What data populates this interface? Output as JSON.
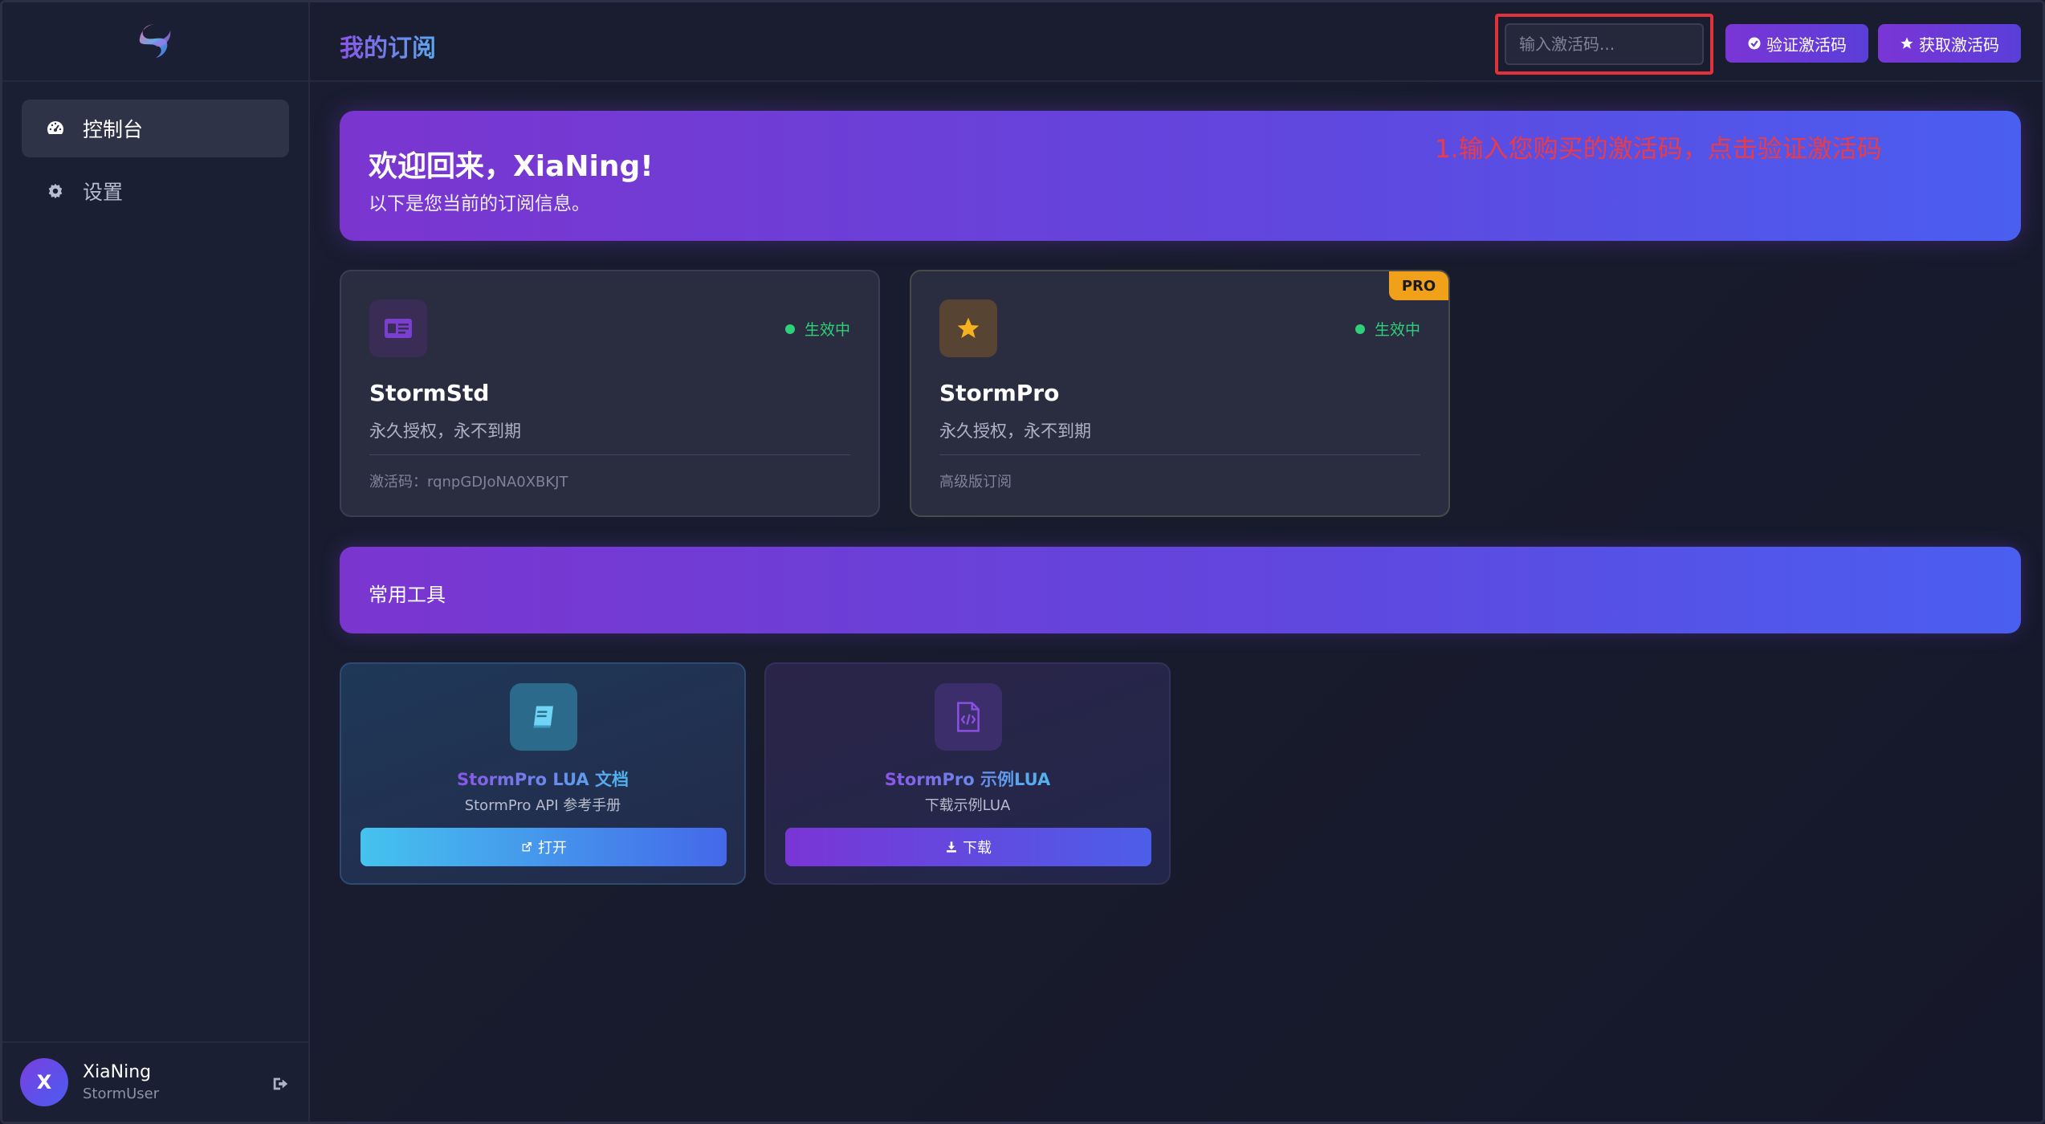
{
  "header": {
    "title": "我的订阅",
    "code_placeholder": "输入激活码...",
    "verify_label": "验证激活码",
    "get_label": "获取激活码"
  },
  "sidebar": {
    "items": [
      {
        "label": "控制台",
        "icon": "dashboard-icon",
        "active": true
      },
      {
        "label": "设置",
        "icon": "gear-icon",
        "active": false
      }
    ],
    "user": {
      "initial": "X",
      "name": "XiaNing",
      "role": "StormUser"
    }
  },
  "welcome": {
    "title": "欢迎回来，XiaNing!",
    "subtitle": "以下是您当前的订阅信息。",
    "annotation": "1.输入您购买的激活码，点击验证激活码"
  },
  "subscriptions": [
    {
      "name": "StormStd",
      "status": "生效中",
      "desc": "永久授权，永不到期",
      "foot": "激活码：rqnpGDJoNA0XBKJT",
      "icon": "id-card-icon"
    },
    {
      "name": "StormPro",
      "status": "生效中",
      "desc": "永久授权，永不到期",
      "foot": "高级版订阅",
      "badge": "PRO",
      "icon": "star-icon"
    }
  ],
  "tools": {
    "section_title": "常用工具",
    "items": [
      {
        "title": "StormPro LUA 文档",
        "desc": "StormPro API 参考手册",
        "button": "打开",
        "icon": "book-icon"
      },
      {
        "title": "StormPro 示例LUA",
        "desc": "下载示例LUA",
        "button": "下载",
        "icon": "code-file-icon"
      }
    ]
  },
  "colors": {
    "accent": "#7b35cf",
    "status_active": "#2fd07a",
    "pro_badge": "#f0a019",
    "annotation": "#ec3b45"
  }
}
